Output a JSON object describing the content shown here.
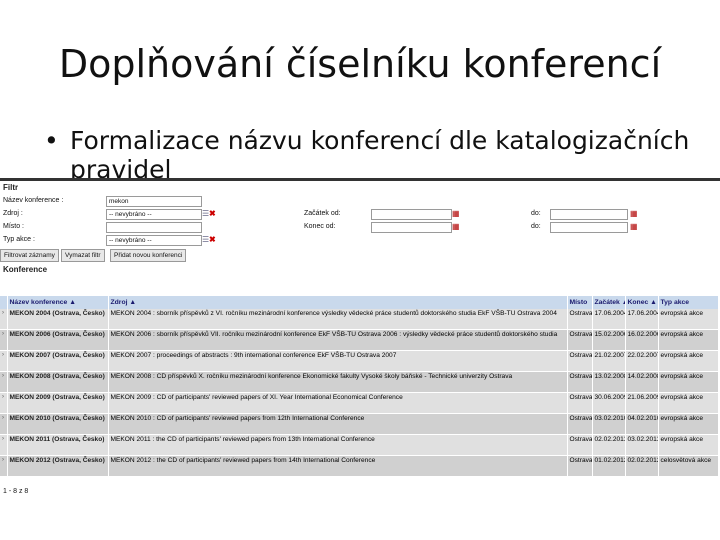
{
  "slide": {
    "title": "Doplňování číselníku konferencí",
    "bullet": "Formalizace názvu konferencí dle katalogizačních pravidel"
  },
  "filter": {
    "heading": "Filtr",
    "fields": {
      "nazev_label": "Název konference :",
      "nazev_value": "mekon",
      "zdroj_label": "Zdroj :",
      "zdroj_value": "-- nevybráno --",
      "misto_label": "Místo :",
      "typ_label": "Typ akce :",
      "typ_value": "-- nevybráno --",
      "zacatek_label": "Začátek od:",
      "konec_label": "Konec od:",
      "do_label": "do:"
    },
    "buttons": {
      "filter": "Filtrovat záznamy",
      "clear": "Vymazat filtr",
      "add": "Přidat novou konferenci"
    }
  },
  "list": {
    "heading": "Konference",
    "columns": {
      "nazev": "Název konference ▲",
      "zdroj": "Zdroj ▲",
      "misto": "Místo",
      "zacatek": "Začátek ▲",
      "konec": "Konec ▲",
      "typ": "Typ akce"
    },
    "rows": [
      {
        "nazev": "MEKON 2004 (Ostrava, Česko)",
        "zdroj": "MEKON 2004 : sborník příspěvků z VI. ročníku mezinárodní konference výsledky vědecké práce studentů doktorského studia EkF VŠB-TU Ostrava 2004",
        "misto": "Ostrava",
        "zacatek": "17.06.2004",
        "konec": "17.06.2004",
        "typ": "evropská akce"
      },
      {
        "nazev": "MEKON 2006 (Ostrava, Česko)",
        "zdroj": "MEKON 2006 : sborník příspěvků VII. ročníku mezinárodní konference EkF VŠB-TU Ostrava 2006 : výsledky vědecké práce studentů doktorského studia",
        "misto": "Ostrava",
        "zacatek": "15.02.2006",
        "konec": "16.02.2006",
        "typ": "evropská akce"
      },
      {
        "nazev": "MEKON 2007 (Ostrava, Česko)",
        "zdroj": "MEKON 2007 : proceedings of abstracts : 9th international conference EkF VŠB-TU Ostrava 2007",
        "misto": "Ostrava",
        "zacatek": "21.02.2007",
        "konec": "22.02.2007",
        "typ": "evropská akce"
      },
      {
        "nazev": "MEKON 2008 (Ostrava, Česko)",
        "zdroj": "MEKON 2008 : CD příspěvků X. ročníku mezinárodní konference Ekonomické fakulty Vysoké školy báňské - Technické univerzity Ostrava",
        "misto": "Ostrava",
        "zacatek": "13.02.2008",
        "konec": "14.02.2008",
        "typ": "evropská akce"
      },
      {
        "nazev": "MEKON 2009 (Ostrava, Česko)",
        "zdroj": "MEKON 2009 : CD of participants' reviewed papers of XI. Year International Economical Conference",
        "misto": "Ostrava",
        "zacatek": "30.06.2009",
        "konec": "21.06.2009",
        "typ": "evropská akce"
      },
      {
        "nazev": "MEKON 2010 (Ostrava, Česko)",
        "zdroj": "MEKON 2010 : CD of participants' reviewed papers from 12th International Conference",
        "misto": "Ostrava",
        "zacatek": "03.02.2010",
        "konec": "04.02.2010",
        "typ": "evropská akce"
      },
      {
        "nazev": "MEKON 2011 (Ostrava, Česko)",
        "zdroj": "MEKON 2011 : the CD of participants' reviewed papers from 13th International Conference",
        "misto": "Ostrava",
        "zacatek": "02.02.2011",
        "konec": "03.02.2011",
        "typ": "evropská akce"
      },
      {
        "nazev": "MEKON 2012 (Ostrava, Česko)",
        "zdroj": "MEKON 2012 : the CD of participants' reviewed papers from 14th International Conference",
        "misto": "Ostrava",
        "zacatek": "01.02.2012",
        "konec": "02.02.2012",
        "typ": "celosvětová akce"
      }
    ],
    "pager": "1 - 8 z 8"
  }
}
